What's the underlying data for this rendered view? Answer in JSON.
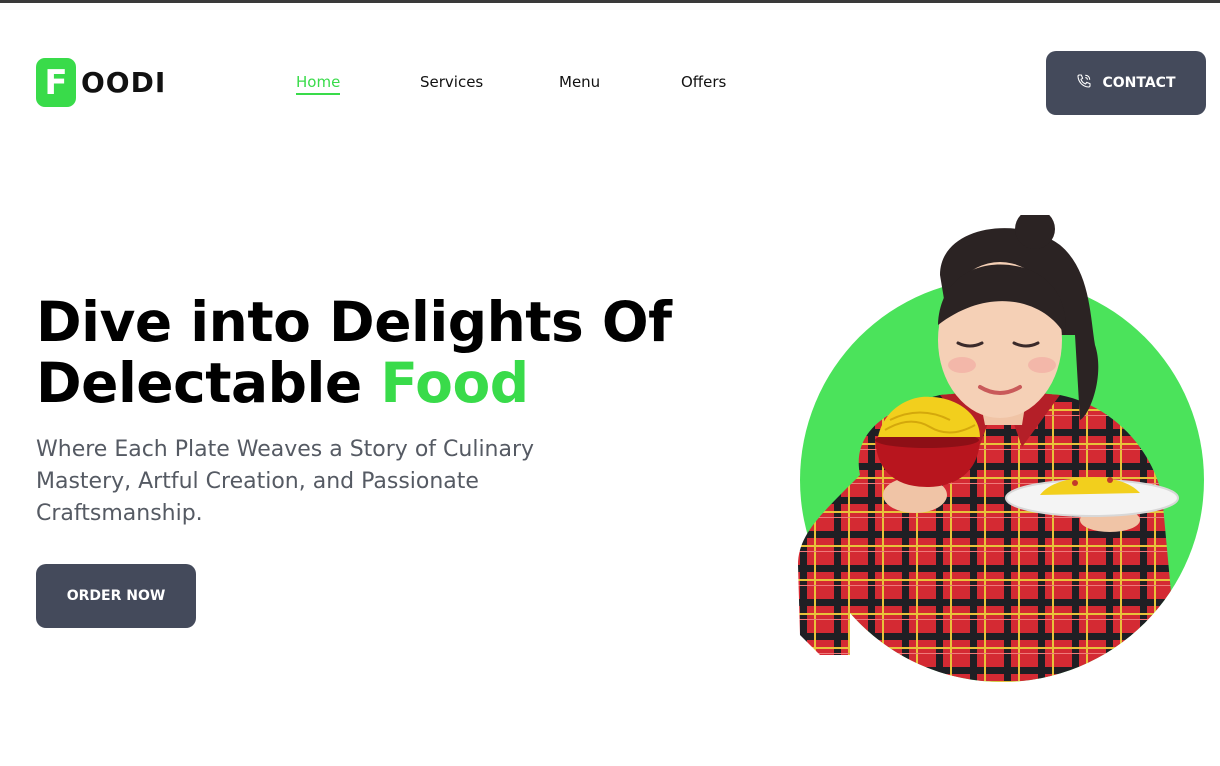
{
  "brand": {
    "initial": "F",
    "rest": "OODI",
    "accent_color": "#39db4a"
  },
  "nav": {
    "items": [
      {
        "label": "Home",
        "active": true
      },
      {
        "label": "Services",
        "active": false
      },
      {
        "label": "Menu",
        "active": false
      },
      {
        "label": "Offers",
        "active": false
      }
    ]
  },
  "header": {
    "contact_label": "CONTACT",
    "contact_icon": "phone-icon"
  },
  "hero": {
    "headline_line1": "Dive into Delights Of",
    "headline_line2_prefix": "Delectable",
    "headline_accent": "Food",
    "subheadline": "Where Each Plate Weaves a Story of Culinary Mastery, Artful Creation, and Passionate Craftsmanship.",
    "cta_label": "ORDER NOW",
    "image_subject": "woman-eating-noodles"
  },
  "colors": {
    "accent": "#39db4a",
    "button_bg": "#444a5b",
    "text_muted": "#555a63"
  }
}
